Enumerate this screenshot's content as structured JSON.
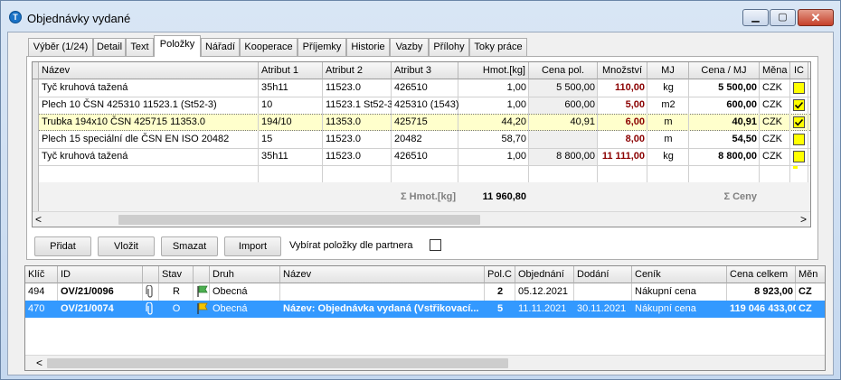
{
  "window": {
    "title": "Objednávky vydané",
    "icon": "app-logo-icon"
  },
  "tabs": [
    {
      "label": "Výběr (1/24)",
      "active": false
    },
    {
      "label": "Detail",
      "active": false
    },
    {
      "label": "Text",
      "active": false
    },
    {
      "label": "Položky",
      "active": true
    },
    {
      "label": "Nářadí",
      "active": false
    },
    {
      "label": "Kooperace",
      "active": false
    },
    {
      "label": "Příjemky",
      "active": false
    },
    {
      "label": "Historie",
      "active": false
    },
    {
      "label": "Vazby",
      "active": false
    },
    {
      "label": "Přílohy",
      "active": false
    },
    {
      "label": "Toky práce",
      "active": false
    }
  ],
  "items": {
    "columns": [
      "Název",
      "Atribut 1",
      "Atribut 2",
      "Atribut 3",
      "Hmot.[kg]",
      "Cena pol.",
      "Množství",
      "MJ",
      "Cena / MJ",
      "Měna",
      "IC"
    ],
    "rows": [
      {
        "nazev": "Tyč kruhová tažená",
        "a1": "35h11",
        "a2": "11523.0",
        "a3": "426510",
        "hmot": "1,00",
        "cena_pol": "5 500,00",
        "mnozstvi": "110,00",
        "mj": "kg",
        "cena_mj": "5 500,00",
        "mena": "CZK",
        "ic": false
      },
      {
        "nazev": "Plech 10 ČSN 425310 11523.1 (St52-3)",
        "a1": "10",
        "a2": "11523.1 St52-3",
        "a3": "425310 (1543)",
        "hmot": "1,00",
        "cena_pol": "600,00",
        "mnozstvi": "5,00",
        "mj": "m2",
        "cena_mj": "600,00",
        "mena": "CZK",
        "ic": true
      },
      {
        "nazev": "Trubka 194x10 ČSN 425715 11353.0",
        "a1": "194/10",
        "a2": "11353.0",
        "a3": "425715",
        "hmot": "44,20",
        "cena_pol": "40,91",
        "mnozstvi": "6,00",
        "mj": "m",
        "cena_mj": "40,91",
        "mena": "CZK",
        "ic": true
      },
      {
        "nazev": "Plech 15 speciální dle ČSN EN ISO 20482",
        "a1": "15",
        "a2": "11523.0",
        "a3": "20482",
        "hmot": "58,70",
        "cena_pol": "",
        "mnozstvi": "8,00",
        "mj": "m",
        "cena_mj": "54,50",
        "mena": "CZK",
        "ic": false
      },
      {
        "nazev": "Tyč kruhová tažená",
        "a1": "35h11",
        "a2": "11523.0",
        "a3": "426510",
        "hmot": "1,00",
        "cena_pol": "8 800,00",
        "mnozstvi": "11 111,00",
        "mj": "kg",
        "cena_mj": "8 800,00",
        "mena": "CZK",
        "ic": false
      }
    ],
    "summary": {
      "hmot_label": "Σ Hmot.[kg]",
      "hmot_value": "11 960,80",
      "ceny_label": "Σ Ceny"
    }
  },
  "buttons": {
    "pridat": "Přidat",
    "vlozit": "Vložit",
    "smazat": "Smazat",
    "import": "Import"
  },
  "partner_filter": {
    "label": "Vybírat položky dle partnera",
    "checked": false
  },
  "orders": {
    "columns": [
      "Klíč",
      "ID",
      "",
      "Stav",
      "",
      "Druh",
      "Název",
      "Pol.C",
      "Objednání",
      "Dodání",
      "Ceník",
      "Cena celkem",
      "Měn"
    ],
    "rows": [
      {
        "klic": "494",
        "id": "OV/21/0096",
        "stav": "R",
        "druh": "Obecná",
        "nazev": "",
        "polc": "2",
        "objednani": "05.12.2021",
        "dodani": "",
        "cenik": "Nákupní cena",
        "cena": "8 923,00",
        "mena": "CZ",
        "selected": false
      },
      {
        "klic": "470",
        "id": "OV/21/0074",
        "stav": "O",
        "druh": "Obecná",
        "nazev": "Název: Objednávka vydaná (Vstřikovací...",
        "polc": "5",
        "objednani": "11.11.2021",
        "dodani": "30.11.2021",
        "cenik": "Nákupní cena",
        "cena": "119 046 433,00",
        "mena": "CZ",
        "selected": true
      }
    ]
  },
  "colors": {
    "selection": "#3399ff",
    "highlight_row": "#ffffcc",
    "checkbox": "#ffff00",
    "dark_red": "#8b0000"
  }
}
